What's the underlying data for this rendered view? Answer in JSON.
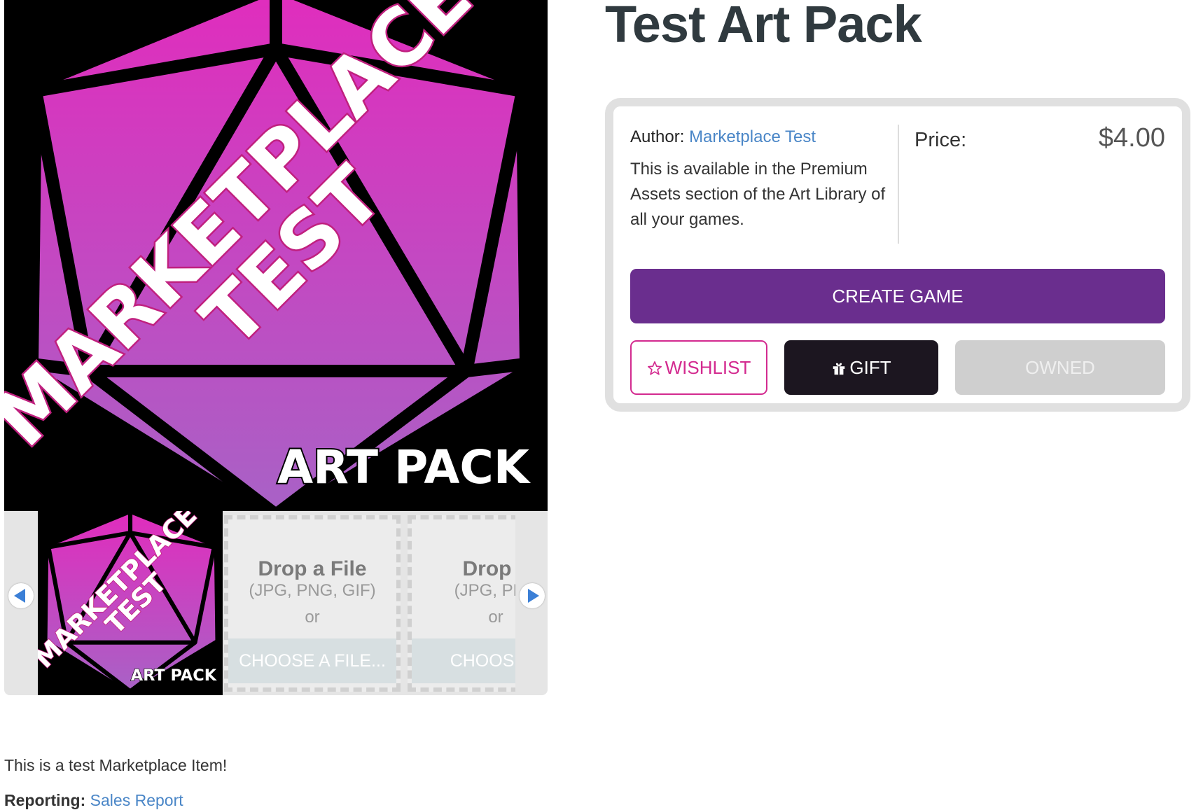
{
  "product": {
    "title": "Test Art Pack",
    "author_label": "Author:",
    "author_name": "Marketplace Test",
    "availability_text": "This is available in the Premium Assets section of the Art Library of all your games.",
    "price_label": "Price:",
    "price_value": "$4.00"
  },
  "buttons": {
    "create_game": "CREATE GAME",
    "wishlist": "WISHLIST",
    "gift": "GIFT",
    "owned": "OWNED"
  },
  "artwork": {
    "line1": "MARKETPLACE",
    "line2": "TEST",
    "label": "ART PACK"
  },
  "drop_zone": {
    "title": "Drop a File",
    "types": "(JPG, PNG, GIF)",
    "or": "or",
    "choose": "CHOOSE A FILE..."
  },
  "drop_zone_partial": {
    "title": "Drop a",
    "types": "(JPG, PNC",
    "or": "or",
    "choose": "CHOOSE A"
  },
  "description": "This is a test Marketplace Item!",
  "reporting": {
    "label": "Reporting:",
    "link": "Sales Report"
  },
  "colors": {
    "accent_purple": "#6a2e8e",
    "wishlist_pink": "#d32a8f",
    "gift_dark": "#1c1620",
    "owned_gray": "#cfcfcf",
    "link_blue": "#4a86c7",
    "art_magenta_top": "#e02dbd",
    "art_magenta_bottom": "#a862c6"
  },
  "icons": {
    "wishlist": "star-outline-icon",
    "gift": "gift-icon",
    "carousel_prev": "arrow-left-icon",
    "carousel_next": "arrow-right-icon"
  }
}
